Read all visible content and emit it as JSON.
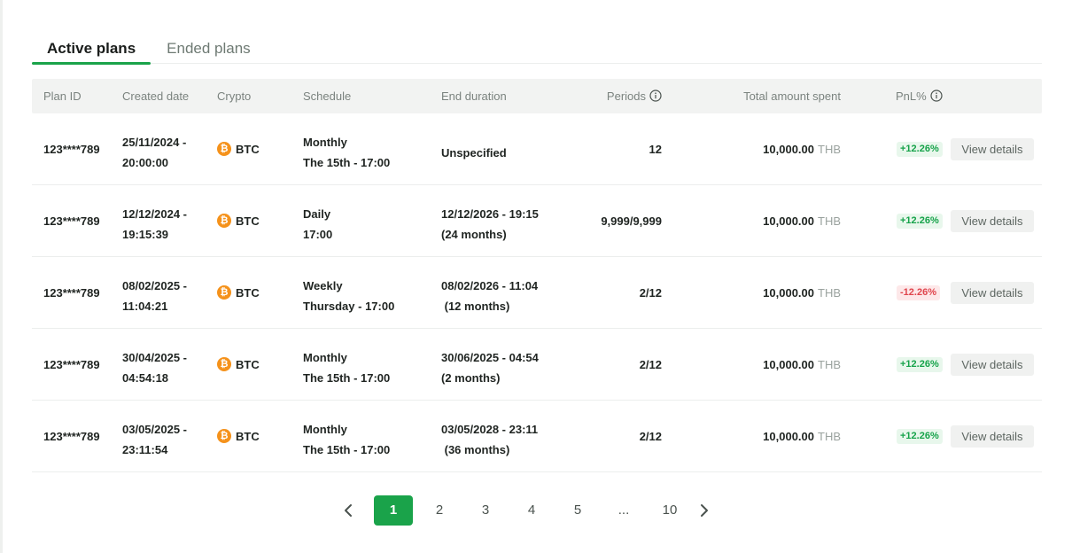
{
  "tabs": [
    {
      "label": "Active plans",
      "active": true
    },
    {
      "label": "Ended plans",
      "active": false
    }
  ],
  "columns": {
    "plan_id": "Plan ID",
    "created_date": "Created date",
    "crypto": "Crypto",
    "schedule": "Schedule",
    "end_duration": "End duration",
    "periods": "Periods",
    "total_spent": "Total amount spent",
    "pnl": "PnL%"
  },
  "rows": [
    {
      "plan_id": "123****789",
      "created_1": "25/11/2024 -",
      "created_2": "20:00:00",
      "crypto": "BTC",
      "schedule_1": "Monthly",
      "schedule_2": "The 15th - 17:00",
      "end_1": "Unspecified",
      "end_2": "",
      "periods": "12",
      "amount": "10,000.00",
      "currency": "THB",
      "pnl": "+12.26%",
      "pnl_sign": "pos",
      "action": "View details"
    },
    {
      "plan_id": "123****789",
      "created_1": "12/12/2024 -",
      "created_2": "19:15:39",
      "crypto": "BTC",
      "schedule_1": "Daily",
      "schedule_2": "17:00",
      "end_1": "12/12/2026 - 19:15",
      "end_2": "(24 months)",
      "periods": "9,999/9,999",
      "amount": "10,000.00",
      "currency": "THB",
      "pnl": "+12.26%",
      "pnl_sign": "pos",
      "action": "View details"
    },
    {
      "plan_id": "123****789",
      "created_1": "08/02/2025 -",
      "created_2": "11:04:21",
      "crypto": "BTC",
      "schedule_1": "Weekly",
      "schedule_2": "Thursday - 17:00",
      "end_1": "08/02/2026 - 11:04",
      "end_2": " (12 months)",
      "periods": "2/12",
      "amount": "10,000.00",
      "currency": "THB",
      "pnl": "-12.26%",
      "pnl_sign": "neg",
      "action": "View details"
    },
    {
      "plan_id": "123****789",
      "created_1": "30/04/2025 -",
      "created_2": "04:54:18",
      "crypto": "BTC",
      "schedule_1": "Monthly",
      "schedule_2": "The 15th - 17:00",
      "end_1": "30/06/2025 - 04:54",
      "end_2": "(2 months)",
      "periods": "2/12",
      "amount": "10,000.00",
      "currency": "THB",
      "pnl": "+12.26%",
      "pnl_sign": "pos",
      "action": "View details"
    },
    {
      "plan_id": "123****789",
      "created_1": "03/05/2025 -",
      "created_2": "23:11:54",
      "crypto": "BTC",
      "schedule_1": "Monthly",
      "schedule_2": "The 15th - 17:00",
      "end_1": "03/05/2028 - 23:11",
      "end_2": " (36 months)",
      "periods": "2/12",
      "amount": "10,000.00",
      "currency": "THB",
      "pnl": "+12.26%",
      "pnl_sign": "pos",
      "action": "View details"
    }
  ],
  "pagination": {
    "pages": [
      "1",
      "2",
      "3",
      "4",
      "5",
      "...",
      "10"
    ],
    "current": "1"
  },
  "colors": {
    "accent": "#1aa34a",
    "positive": "#16a34a",
    "negative": "#e0454d",
    "btc": "#f5921b"
  },
  "icons": {
    "btc": "₿"
  }
}
